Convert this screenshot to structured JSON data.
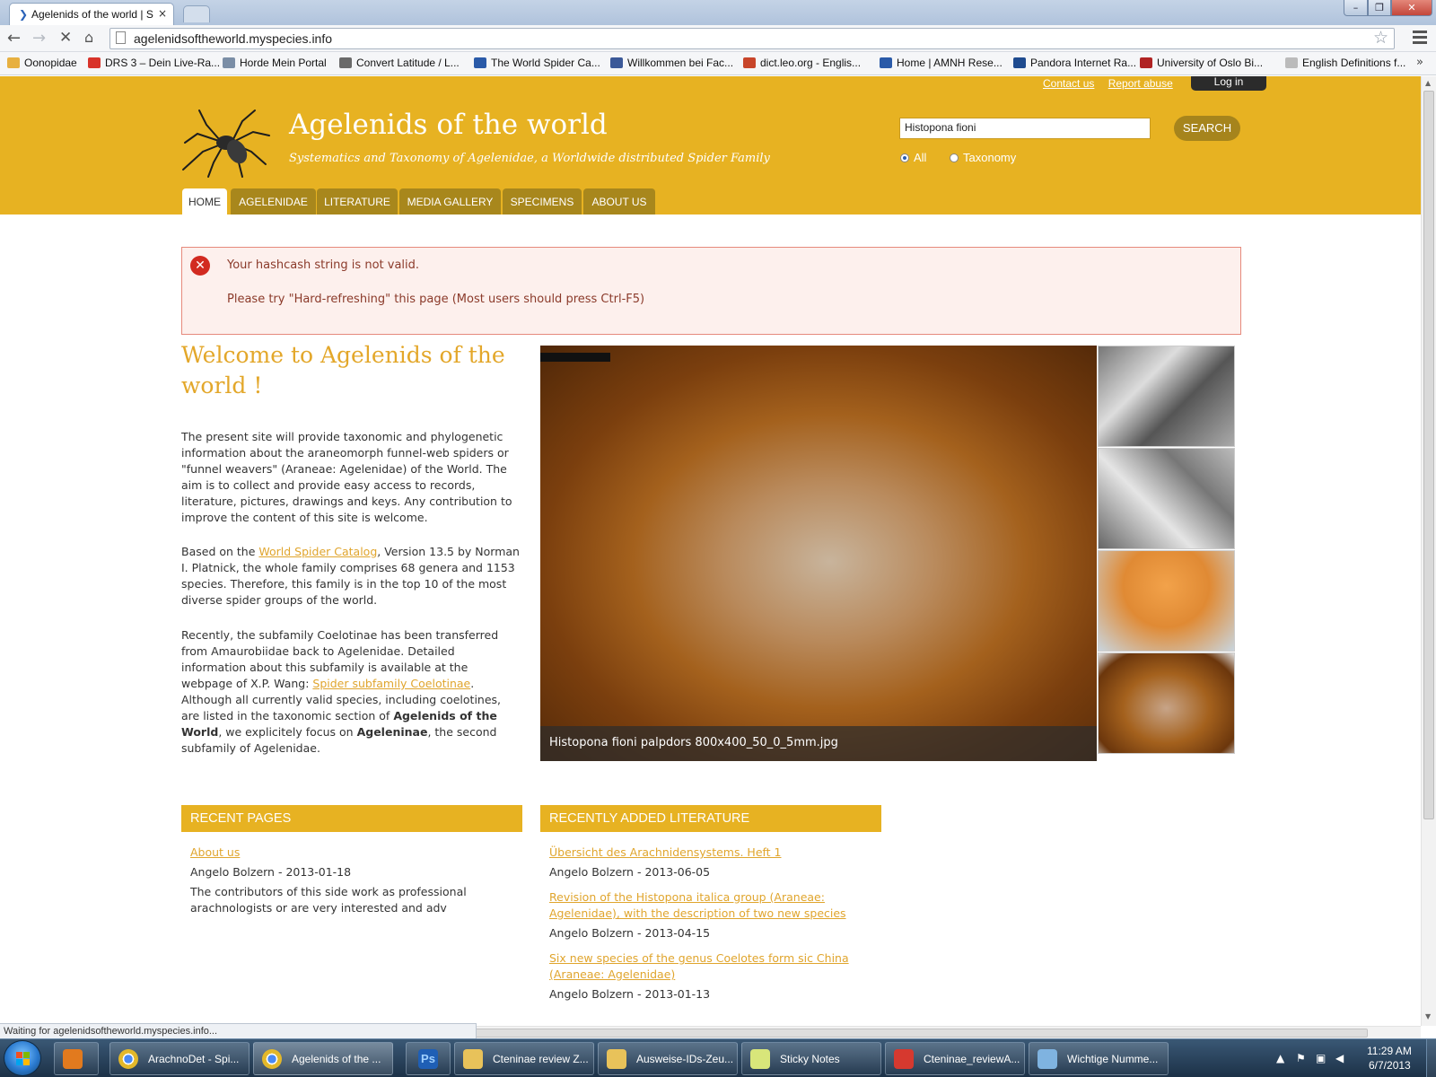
{
  "browser": {
    "active_tab_title": "Agelenids of the world | Sp",
    "tab_close": "×",
    "url": "agelenidsoftheworld.myspecies.info",
    "bookmarks": [
      {
        "label": "Oonopidae",
        "color": "#e7b040"
      },
      {
        "label": "DRS 3 – Dein Live-Ra...",
        "color": "#d8332a"
      },
      {
        "label": "Horde Mein Portal",
        "color": "#7b8ea6"
      },
      {
        "label": "Convert Latitude / L...",
        "color": "#6a6a6a"
      },
      {
        "label": "The World Spider Ca...",
        "color": "#2a5aa8"
      },
      {
        "label": "Willkommen bei Fac...",
        "color": "#3b5998"
      },
      {
        "label": "dict.leo.org - Englis...",
        "color": "#c8452a"
      },
      {
        "label": "Home | AMNH Rese...",
        "color": "#2a5aa8"
      },
      {
        "label": "Pandora Internet Ra...",
        "color": "#1f4b8f"
      },
      {
        "label": "University of Oslo Bi...",
        "color": "#b02323"
      },
      {
        "label": "English Definitions f...",
        "color": "#bbbbbb"
      }
    ],
    "bookmark_overflow": "»",
    "status_text": "Waiting for agelenidsoftheworld.myspecies.info..."
  },
  "site": {
    "contact_link": "Contact us",
    "report_link": "Report abuse",
    "login_label": "Log in",
    "title": "Agelenids of the world",
    "slogan": "Systematics and Taxonomy of Agelenidae, a Worldwide distributed Spider Family",
    "search_value": "Histopona fioni",
    "search_button": "SEARCH",
    "radio_all": "All",
    "radio_taxonomy": "Taxonomy",
    "nav": [
      "HOME",
      "AGELENIDAE",
      "LITERATURE",
      "MEDIA GALLERY",
      "SPECIMENS",
      "ABOUT US"
    ]
  },
  "error": {
    "line1": "Your hashcash string is not valid.",
    "line2": "Please try \"Hard-refreshing\" this page (Most users should press Ctrl-F5)"
  },
  "welcome": {
    "title": "Welcome to Agelenids of the world !",
    "p1": "The present site will provide taxonomic and phylogenetic information about the araneomorph funnel-web spiders or \"funnel weavers\" (Araneae: Agelenidae) of the World. The aim is to collect and provide easy access to records, literature, pictures, drawings and keys. Any contribution to improve the content of this site is welcome.",
    "p2_before": "Based on the ",
    "p2_link": "World Spider Catalog",
    "p2_after": ", Version 13.5 by Norman I. Platnick, the whole family comprises 68 genera and 1153 species. Therefore, this family is in the top 10 of the most diverse spider groups of the world.",
    "p3_a": "Recently, the subfamily Coelotinae has been transferred from Amaurobiidae back to Agelenidae. Detailed information about this subfamily is available at the webpage of X.P. Wang: ",
    "p3_link": "Spider subfamily Coelotinae",
    "p3_b": ". Although all currently valid species, including coelotines, are listed in the taxonomic section of ",
    "p3_bold1": "Agelenids of the World",
    "p3_c": ", we explicitely focus on ",
    "p3_bold2": "Ageleninae",
    "p3_d": ", the second subfamily of Agelenidae."
  },
  "slideshow": {
    "caption": "Histopona fioni palpdors 800x400_50_0_5mm.jpg"
  },
  "recent_pages": {
    "heading": "RECENT PAGES",
    "items": [
      {
        "title": "About us",
        "meta": "Angelo Bolzern - 2013-01-18",
        "teaser": "The contributors of this side work as professional arachnologists or are very interested and adv"
      }
    ]
  },
  "recent_literature": {
    "heading": "RECENTLY ADDED LITERATURE",
    "items": [
      {
        "title": "Übersicht des Arachnidensystems. Heft 1",
        "meta": "Angelo Bolzern - 2013-06-05"
      },
      {
        "title": "Revision of the Histopona italica group (Araneae: Agelenidae), with the description of two new species",
        "meta": "Angelo Bolzern - 2013-04-15"
      },
      {
        "title": "Six new species of the genus Coelotes form sic China (Araneae: Agelenidae)",
        "meta": "Angelo Bolzern - 2013-01-13"
      }
    ]
  },
  "taskbar": {
    "items": [
      {
        "label": "ArachnoDet - Spi...",
        "icon": "chrome-icon"
      },
      {
        "label": "Agelenids of the ...",
        "icon": "chrome-icon"
      },
      {
        "label": "",
        "icon": "photoshop-icon"
      },
      {
        "label": "Cteninae review Z...",
        "icon": "folder-icon"
      },
      {
        "label": "Ausweise-IDs-Zeu...",
        "icon": "folder-icon"
      },
      {
        "label": "Sticky Notes",
        "icon": "sticky-notes-icon"
      },
      {
        "label": "Cteninae_reviewA...",
        "icon": "pdf-icon"
      },
      {
        "label": "Wichtige Numme...",
        "icon": "notepad-icon"
      }
    ],
    "photoshop_glyph": "Ps",
    "clock_time": "11:29 AM",
    "clock_date": "6/7/2013"
  },
  "colors": {
    "header_gold": "#e7b222",
    "nav_tab": "#a8871c",
    "link_gold": "#e0a52d",
    "error_border": "#e68a7c"
  }
}
